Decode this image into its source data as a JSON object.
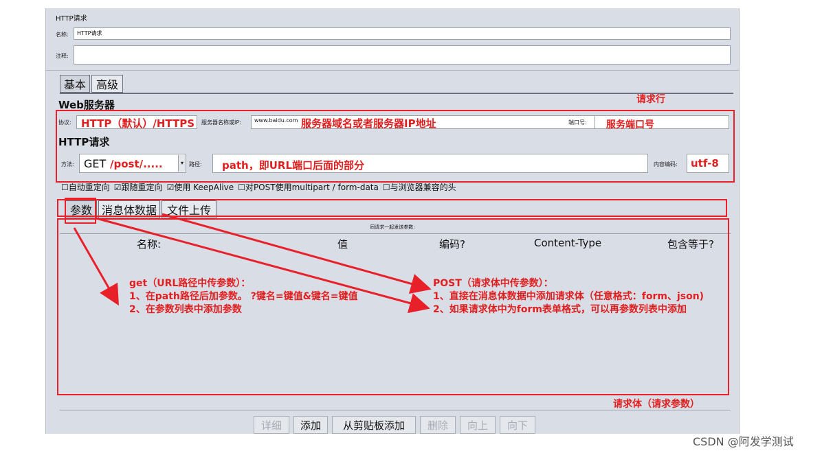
{
  "panel": {
    "title": "HTTP请求",
    "name_label": "名称:",
    "name_value": "HTTP请求",
    "comment_label": "注释:",
    "comment_value": ""
  },
  "tabs": [
    {
      "label": "基本"
    },
    {
      "label": "高级"
    }
  ],
  "web_server": {
    "title": "Web服务器",
    "protocol_label": "协议:",
    "protocol_value": "",
    "server_label": "服务器名称或IP:",
    "server_value": "www.baidu.com",
    "port_label": "端口号:",
    "port_value": ""
  },
  "http_request": {
    "title": "HTTP请求",
    "method_label": "方法:",
    "method_value": "GET",
    "path_label": "路径:",
    "path_value": "",
    "encoding_label": "内容编码:",
    "encoding_value": ""
  },
  "checkboxes": [
    {
      "label": "自动重定向",
      "checked": false
    },
    {
      "label": "跟随重定向",
      "checked": true
    },
    {
      "label": "使用 KeepAlive",
      "checked": true
    },
    {
      "label": "对POST使用multipart / form-data",
      "checked": false
    },
    {
      "label": "与浏览器兼容的头",
      "checked": false
    }
  ],
  "subtabs": [
    {
      "label": "参数"
    },
    {
      "label": "消息体数据"
    },
    {
      "label": "文件上传"
    }
  ],
  "params": {
    "caption": "同请求一起发送参数:",
    "columns": [
      "名称:",
      "值",
      "编码?",
      "Content-Type",
      "包含等于?"
    ]
  },
  "buttons": {
    "detail": "详细",
    "add": "添加",
    "add_clipboard": "从剪贴板添加",
    "delete": "删除",
    "up": "向上",
    "down": "向下"
  },
  "annotations": {
    "request_line": "请求行",
    "protocol_note": "HTTP（默认）/HTTPS",
    "server_note": "服务器域名或者服务器IP地址",
    "port_note": "服务端口号",
    "method_note": "/post/.....",
    "path_note": "path，即URL端口后面的部分",
    "encoding_note": "utf-8",
    "get_title": "get（URL路径中传参数）：",
    "get_1": "1、在path路径后加参数。 ?键名=键值&键名=键值",
    "get_2": "2、在参数列表中添加参数",
    "post_title": "POST（请求体中传参数）：",
    "post_1": "1、直接在消息体数据中添加请求体（任意格式：form、json)",
    "post_2": "2、如果请求体中为form表单格式，可以再参数列表中添加",
    "body_note": "请求体（请求参数）"
  },
  "watermark": "CSDN @阿发学测试",
  "colors": {
    "annotation_red": "#e8202a",
    "panel_bg": "#d9dde5"
  }
}
